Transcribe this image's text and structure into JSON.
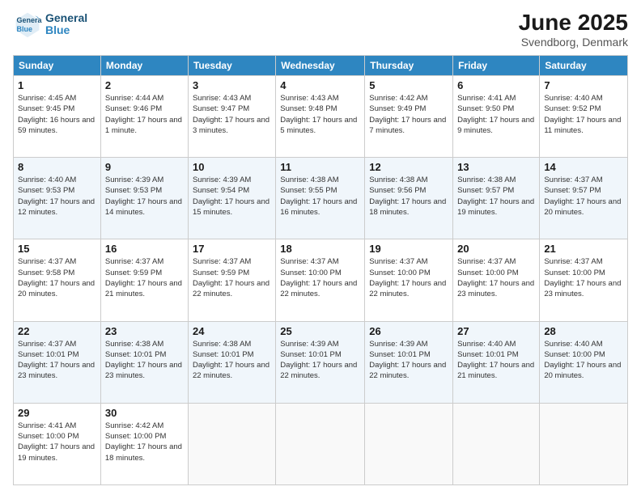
{
  "logo": {
    "line1": "General",
    "line2": "Blue"
  },
  "title": "June 2025",
  "subtitle": "Svendborg, Denmark",
  "days_header": [
    "Sunday",
    "Monday",
    "Tuesday",
    "Wednesday",
    "Thursday",
    "Friday",
    "Saturday"
  ],
  "weeks": [
    [
      {
        "day": "1",
        "sunrise": "Sunrise: 4:45 AM",
        "sunset": "Sunset: 9:45 PM",
        "daylight": "Daylight: 16 hours and 59 minutes."
      },
      {
        "day": "2",
        "sunrise": "Sunrise: 4:44 AM",
        "sunset": "Sunset: 9:46 PM",
        "daylight": "Daylight: 17 hours and 1 minute."
      },
      {
        "day": "3",
        "sunrise": "Sunrise: 4:43 AM",
        "sunset": "Sunset: 9:47 PM",
        "daylight": "Daylight: 17 hours and 3 minutes."
      },
      {
        "day": "4",
        "sunrise": "Sunrise: 4:43 AM",
        "sunset": "Sunset: 9:48 PM",
        "daylight": "Daylight: 17 hours and 5 minutes."
      },
      {
        "day": "5",
        "sunrise": "Sunrise: 4:42 AM",
        "sunset": "Sunset: 9:49 PM",
        "daylight": "Daylight: 17 hours and 7 minutes."
      },
      {
        "day": "6",
        "sunrise": "Sunrise: 4:41 AM",
        "sunset": "Sunset: 9:50 PM",
        "daylight": "Daylight: 17 hours and 9 minutes."
      },
      {
        "day": "7",
        "sunrise": "Sunrise: 4:40 AM",
        "sunset": "Sunset: 9:52 PM",
        "daylight": "Daylight: 17 hours and 11 minutes."
      }
    ],
    [
      {
        "day": "8",
        "sunrise": "Sunrise: 4:40 AM",
        "sunset": "Sunset: 9:53 PM",
        "daylight": "Daylight: 17 hours and 12 minutes."
      },
      {
        "day": "9",
        "sunrise": "Sunrise: 4:39 AM",
        "sunset": "Sunset: 9:53 PM",
        "daylight": "Daylight: 17 hours and 14 minutes."
      },
      {
        "day": "10",
        "sunrise": "Sunrise: 4:39 AM",
        "sunset": "Sunset: 9:54 PM",
        "daylight": "Daylight: 17 hours and 15 minutes."
      },
      {
        "day": "11",
        "sunrise": "Sunrise: 4:38 AM",
        "sunset": "Sunset: 9:55 PM",
        "daylight": "Daylight: 17 hours and 16 minutes."
      },
      {
        "day": "12",
        "sunrise": "Sunrise: 4:38 AM",
        "sunset": "Sunset: 9:56 PM",
        "daylight": "Daylight: 17 hours and 18 minutes."
      },
      {
        "day": "13",
        "sunrise": "Sunrise: 4:38 AM",
        "sunset": "Sunset: 9:57 PM",
        "daylight": "Daylight: 17 hours and 19 minutes."
      },
      {
        "day": "14",
        "sunrise": "Sunrise: 4:37 AM",
        "sunset": "Sunset: 9:57 PM",
        "daylight": "Daylight: 17 hours and 20 minutes."
      }
    ],
    [
      {
        "day": "15",
        "sunrise": "Sunrise: 4:37 AM",
        "sunset": "Sunset: 9:58 PM",
        "daylight": "Daylight: 17 hours and 20 minutes."
      },
      {
        "day": "16",
        "sunrise": "Sunrise: 4:37 AM",
        "sunset": "Sunset: 9:59 PM",
        "daylight": "Daylight: 17 hours and 21 minutes."
      },
      {
        "day": "17",
        "sunrise": "Sunrise: 4:37 AM",
        "sunset": "Sunset: 9:59 PM",
        "daylight": "Daylight: 17 hours and 22 minutes."
      },
      {
        "day": "18",
        "sunrise": "Sunrise: 4:37 AM",
        "sunset": "Sunset: 10:00 PM",
        "daylight": "Daylight: 17 hours and 22 minutes."
      },
      {
        "day": "19",
        "sunrise": "Sunrise: 4:37 AM",
        "sunset": "Sunset: 10:00 PM",
        "daylight": "Daylight: 17 hours and 22 minutes."
      },
      {
        "day": "20",
        "sunrise": "Sunrise: 4:37 AM",
        "sunset": "Sunset: 10:00 PM",
        "daylight": "Daylight: 17 hours and 23 minutes."
      },
      {
        "day": "21",
        "sunrise": "Sunrise: 4:37 AM",
        "sunset": "Sunset: 10:00 PM",
        "daylight": "Daylight: 17 hours and 23 minutes."
      }
    ],
    [
      {
        "day": "22",
        "sunrise": "Sunrise: 4:37 AM",
        "sunset": "Sunset: 10:01 PM",
        "daylight": "Daylight: 17 hours and 23 minutes."
      },
      {
        "day": "23",
        "sunrise": "Sunrise: 4:38 AM",
        "sunset": "Sunset: 10:01 PM",
        "daylight": "Daylight: 17 hours and 23 minutes."
      },
      {
        "day": "24",
        "sunrise": "Sunrise: 4:38 AM",
        "sunset": "Sunset: 10:01 PM",
        "daylight": "Daylight: 17 hours and 22 minutes."
      },
      {
        "day": "25",
        "sunrise": "Sunrise: 4:39 AM",
        "sunset": "Sunset: 10:01 PM",
        "daylight": "Daylight: 17 hours and 22 minutes."
      },
      {
        "day": "26",
        "sunrise": "Sunrise: 4:39 AM",
        "sunset": "Sunset: 10:01 PM",
        "daylight": "Daylight: 17 hours and 22 minutes."
      },
      {
        "day": "27",
        "sunrise": "Sunrise: 4:40 AM",
        "sunset": "Sunset: 10:01 PM",
        "daylight": "Daylight: 17 hours and 21 minutes."
      },
      {
        "day": "28",
        "sunrise": "Sunrise: 4:40 AM",
        "sunset": "Sunset: 10:00 PM",
        "daylight": "Daylight: 17 hours and 20 minutes."
      }
    ],
    [
      {
        "day": "29",
        "sunrise": "Sunrise: 4:41 AM",
        "sunset": "Sunset: 10:00 PM",
        "daylight": "Daylight: 17 hours and 19 minutes."
      },
      {
        "day": "30",
        "sunrise": "Sunrise: 4:42 AM",
        "sunset": "Sunset: 10:00 PM",
        "daylight": "Daylight: 17 hours and 18 minutes."
      },
      null,
      null,
      null,
      null,
      null
    ]
  ]
}
